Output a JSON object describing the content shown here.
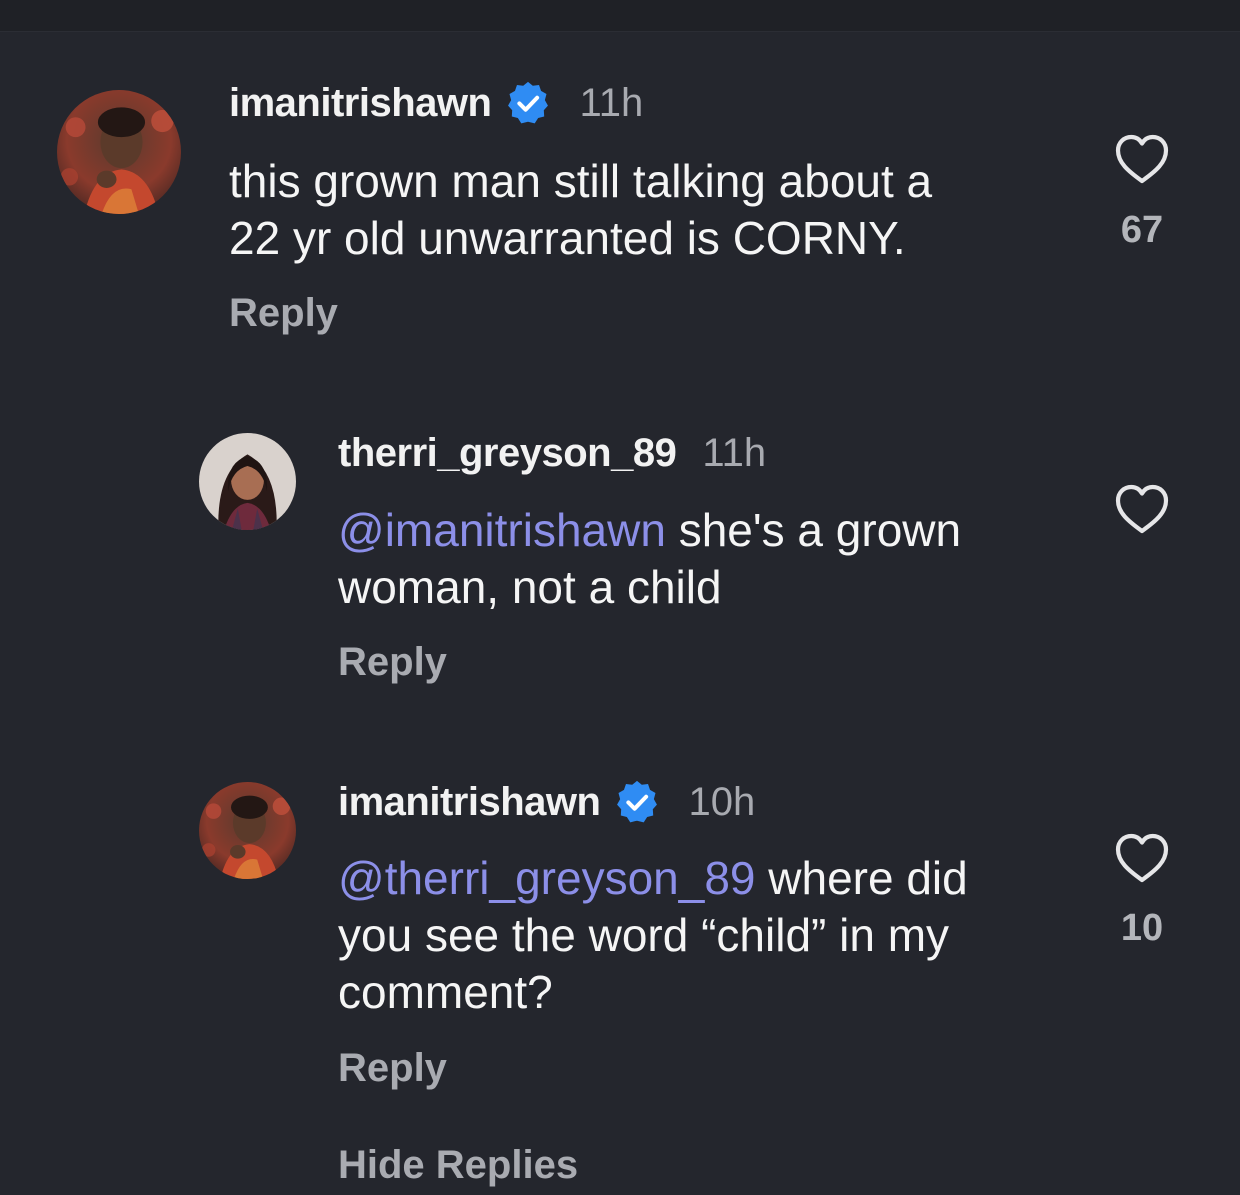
{
  "comments": [
    {
      "username": "imanitrishawn",
      "verified": true,
      "time": "11h",
      "lines": [
        "this grown man still talking about a",
        "22 yr old unwarranted is CORNY."
      ],
      "reply_label": "Reply",
      "likes": "67",
      "avatar_icon": "avatar-photo"
    },
    {
      "username": "therri_greyson_89",
      "verified": false,
      "time": "11h",
      "mention": "@imanitrishawn",
      "line1_rest": " she's a grown",
      "line2": "woman, not a child",
      "reply_label": "Reply",
      "likes": "",
      "avatar_icon": "avatar-photo"
    },
    {
      "username": "imanitrishawn",
      "verified": true,
      "time": "10h",
      "mention": "@therri_greyson_89",
      "line1_rest": " where did",
      "line2": "you see the word “child” in my",
      "line3": "comment?",
      "reply_label": "Reply",
      "likes": "10",
      "avatar_icon": "avatar-photo"
    }
  ],
  "hide_replies_label": "Hide Replies",
  "colors": {
    "background": "#24262d",
    "mention": "#8c8fe8",
    "verified_badge": "#2f8cf3"
  },
  "icons": {
    "like": "heart-outline-icon",
    "verified": "verified-badge-icon"
  }
}
